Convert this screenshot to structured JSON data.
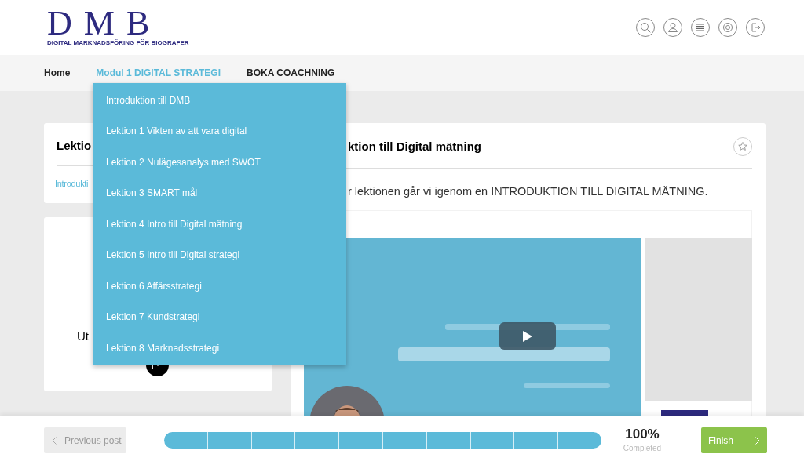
{
  "logo": {
    "letters": "D M B",
    "tagline": "DIGITAL MARKNADSFÖRING FÖR BIOGRAFER"
  },
  "nav": [
    {
      "label": "Home",
      "selected": false
    },
    {
      "label": "Modul 1 DIGITAL STRATEGI",
      "selected": true
    },
    {
      "label": "BOKA COACHNING",
      "selected": false
    }
  ],
  "dropdown": [
    "Introduktion till DMB",
    "Lektion 1 Vikten av att vara digital",
    "Lektion 2 Nulägesanalys med SWOT",
    "Lektion 3 SMART mål",
    "Lektion 4 Intro till Digital mätning",
    "Lektion 5 Intro till Digital strategi",
    "Lektion 6 Affärsstrategi",
    "Lektion 7 Kundstrategi",
    "Lektion 8 Marknadsstrategi"
  ],
  "side_card": {
    "title": "Lektio",
    "link": "Introdukti"
  },
  "author_card": {
    "text": "Ut"
  },
  "lesson": {
    "title": "ktion till Digital mätning",
    "intro": "r lektionen går vi igenom en INTRODUKTION TILL DIGITAL MÄTNING."
  },
  "footer": {
    "previous": {
      "label": "Previous post",
      "disabled": true
    },
    "progress": {
      "level": 1
    },
    "percent": "100%",
    "status": "Completed",
    "finish": "Finish"
  }
}
